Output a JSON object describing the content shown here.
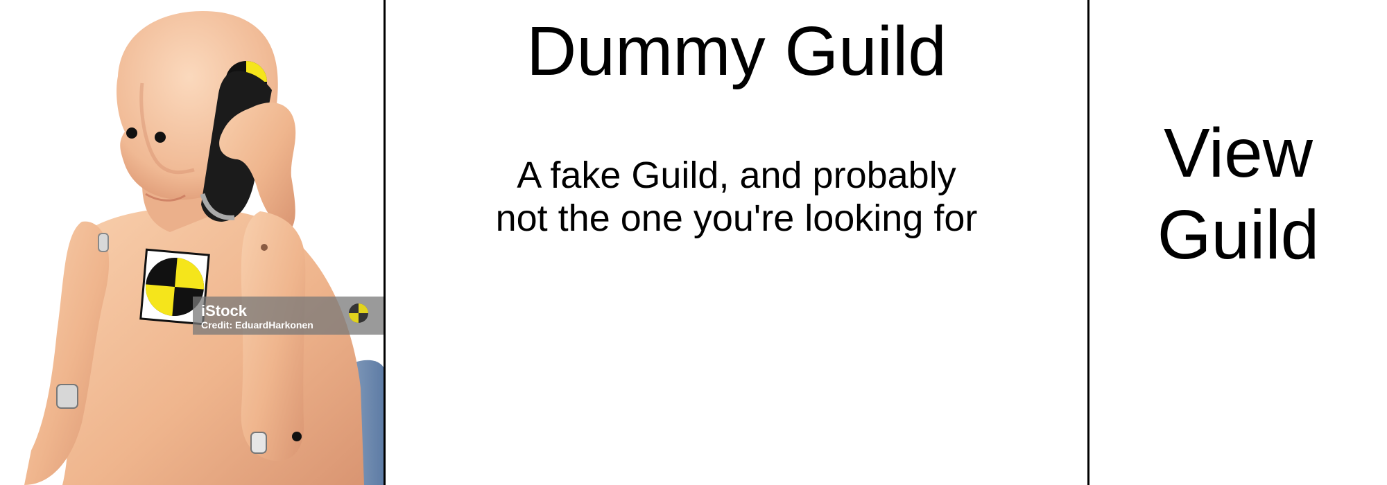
{
  "guild": {
    "name": "Dummy Guild",
    "description": "A fake Guild, and probably not the one you're looking for",
    "image_alt": "crash test dummy on phone"
  },
  "image_watermark": {
    "brand": "iStock",
    "credit": "Credit: EduardHarkonen"
  },
  "actions": {
    "view_label": "View Guild"
  },
  "colors": {
    "background": "#ffffff",
    "border": "#000000",
    "text": "#000000",
    "dummy_skin": "#f3bf97",
    "marker_yellow": "#f5e51b",
    "chair_blue": "#6c87ad"
  },
  "icons": {
    "image": "crash-test-dummy-image"
  }
}
